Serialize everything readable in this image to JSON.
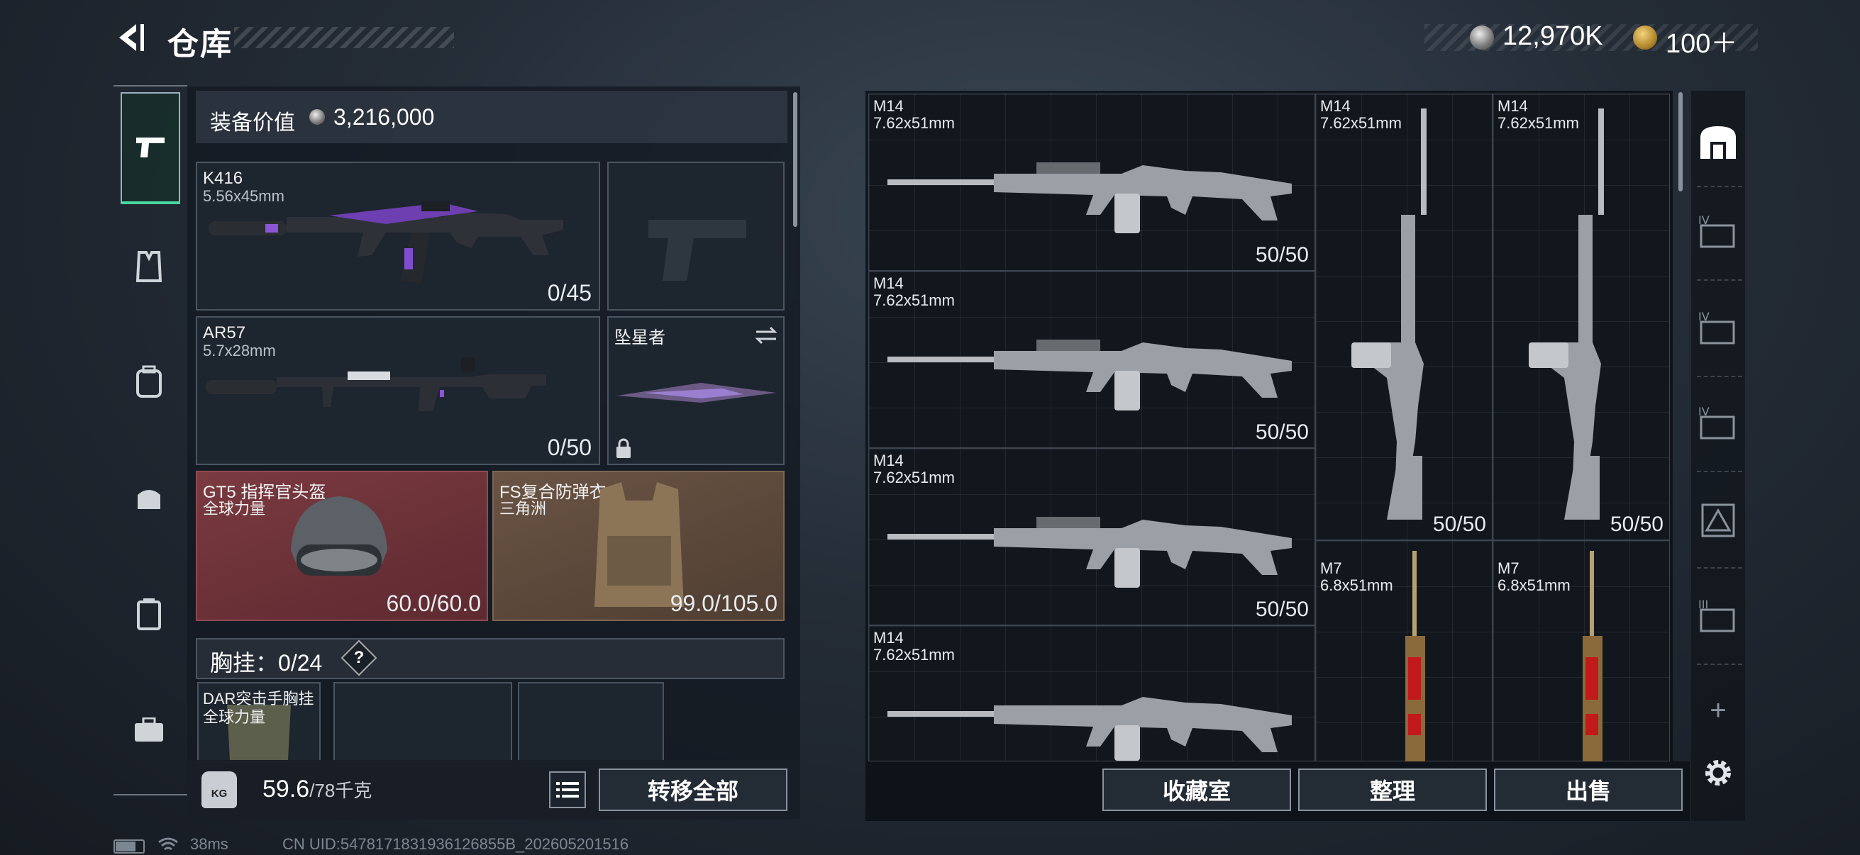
{
  "header": {
    "title": "仓库",
    "money": "12,970K",
    "tickets": "100＋"
  },
  "loadout": {
    "value_label": "装备价值",
    "value": "3,216,000",
    "primary": {
      "name": "K416",
      "ammo": "5.56x45mm",
      "count": "0/45"
    },
    "secondary": {
      "name": "AR57",
      "ammo": "5.7x28mm",
      "count": "0/50"
    },
    "melee": {
      "name": "坠星者"
    },
    "helmet": {
      "name": "GT5 指挥官头盔",
      "faction": "全球力量",
      "durability": "60.0/60.0"
    },
    "armor": {
      "name": "FS复合防弹衣",
      "faction": "三角洲",
      "durability": "99.0/105.0"
    },
    "chest_label": "胸挂：",
    "chest_count": "0/24",
    "chest_help": "?",
    "chest_rig": {
      "name": "DAR突击手胸挂",
      "faction": "全球力量"
    },
    "weight": "59.6",
    "weight_max": "/78千克",
    "weight_icon_label": "KG",
    "transfer_all": "转移全部"
  },
  "storage": {
    "items": [
      {
        "name": "M14",
        "ammo": "7.62x51mm",
        "count": "50/50"
      },
      {
        "name": "M14",
        "ammo": "7.62x51mm",
        "count": "50/50"
      },
      {
        "name": "M14",
        "ammo": "7.62x51mm",
        "count": "50/50"
      },
      {
        "name": "M14",
        "ammo": "7.62x51mm",
        "count": "50/50"
      },
      {
        "name": "M14",
        "ammo": "7.62x51mm",
        "count": "50/50"
      },
      {
        "name": "M14",
        "ammo": "7.62x51mm",
        "count": ""
      },
      {
        "name": "M7",
        "ammo": "6.8x51mm",
        "count": ""
      },
      {
        "name": "M7",
        "ammo": "6.8x51mm",
        "count": ""
      }
    ],
    "collection_room": "收藏室",
    "sort": "整理",
    "sell": "出售"
  },
  "side_tabs": [
    "IV",
    "IV",
    "IV",
    "III"
  ],
  "add_label": "+",
  "status_bar": {
    "ping": "38ms",
    "uid": "CN UID:5478171831936126855B_202605201516"
  },
  "colors": {
    "accent": "#4ad6a0",
    "helmet_bg": "#6e3338",
    "armor_bg": "#5e4a3b"
  }
}
